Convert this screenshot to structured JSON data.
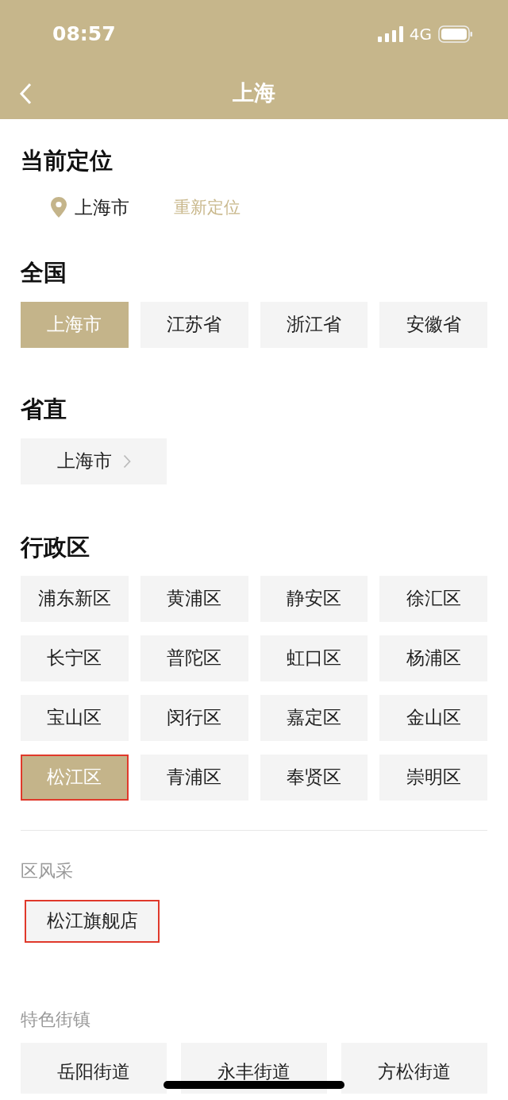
{
  "status_bar": {
    "time": "08:57",
    "network": "4G"
  },
  "nav": {
    "title": "上海"
  },
  "current_location": {
    "heading": "当前定位",
    "city": "上海市",
    "relocate": "重新定位"
  },
  "nationwide": {
    "heading": "全国",
    "items": [
      {
        "label": "上海市",
        "selected": true
      },
      {
        "label": "江苏省",
        "selected": false
      },
      {
        "label": "浙江省",
        "selected": false
      },
      {
        "label": "安徽省",
        "selected": false
      }
    ]
  },
  "provincial": {
    "heading": "省直",
    "items": [
      {
        "label": "上海市"
      }
    ]
  },
  "districts": {
    "heading": "行政区",
    "items": [
      {
        "label": "浦东新区",
        "selected": false,
        "highlighted": false
      },
      {
        "label": "黄浦区",
        "selected": false,
        "highlighted": false
      },
      {
        "label": "静安区",
        "selected": false,
        "highlighted": false
      },
      {
        "label": "徐汇区",
        "selected": false,
        "highlighted": false
      },
      {
        "label": "长宁区",
        "selected": false,
        "highlighted": false
      },
      {
        "label": "普陀区",
        "selected": false,
        "highlighted": false
      },
      {
        "label": "虹口区",
        "selected": false,
        "highlighted": false
      },
      {
        "label": "杨浦区",
        "selected": false,
        "highlighted": false
      },
      {
        "label": "宝山区",
        "selected": false,
        "highlighted": false
      },
      {
        "label": "闵行区",
        "selected": false,
        "highlighted": false
      },
      {
        "label": "嘉定区",
        "selected": false,
        "highlighted": false
      },
      {
        "label": "金山区",
        "selected": false,
        "highlighted": false
      },
      {
        "label": "松江区",
        "selected": true,
        "highlighted": true
      },
      {
        "label": "青浦区",
        "selected": false,
        "highlighted": false
      },
      {
        "label": "奉贤区",
        "selected": false,
        "highlighted": false
      },
      {
        "label": "崇明区",
        "selected": false,
        "highlighted": false
      }
    ]
  },
  "district_showcase": {
    "heading": "区风采",
    "items": [
      {
        "label": "松江旗舰店",
        "highlighted": true
      }
    ]
  },
  "featured_towns": {
    "heading": "特色街镇",
    "items": [
      {
        "label": "岳阳街道"
      },
      {
        "label": "永丰街道"
      },
      {
        "label": "方松街道"
      }
    ]
  }
}
